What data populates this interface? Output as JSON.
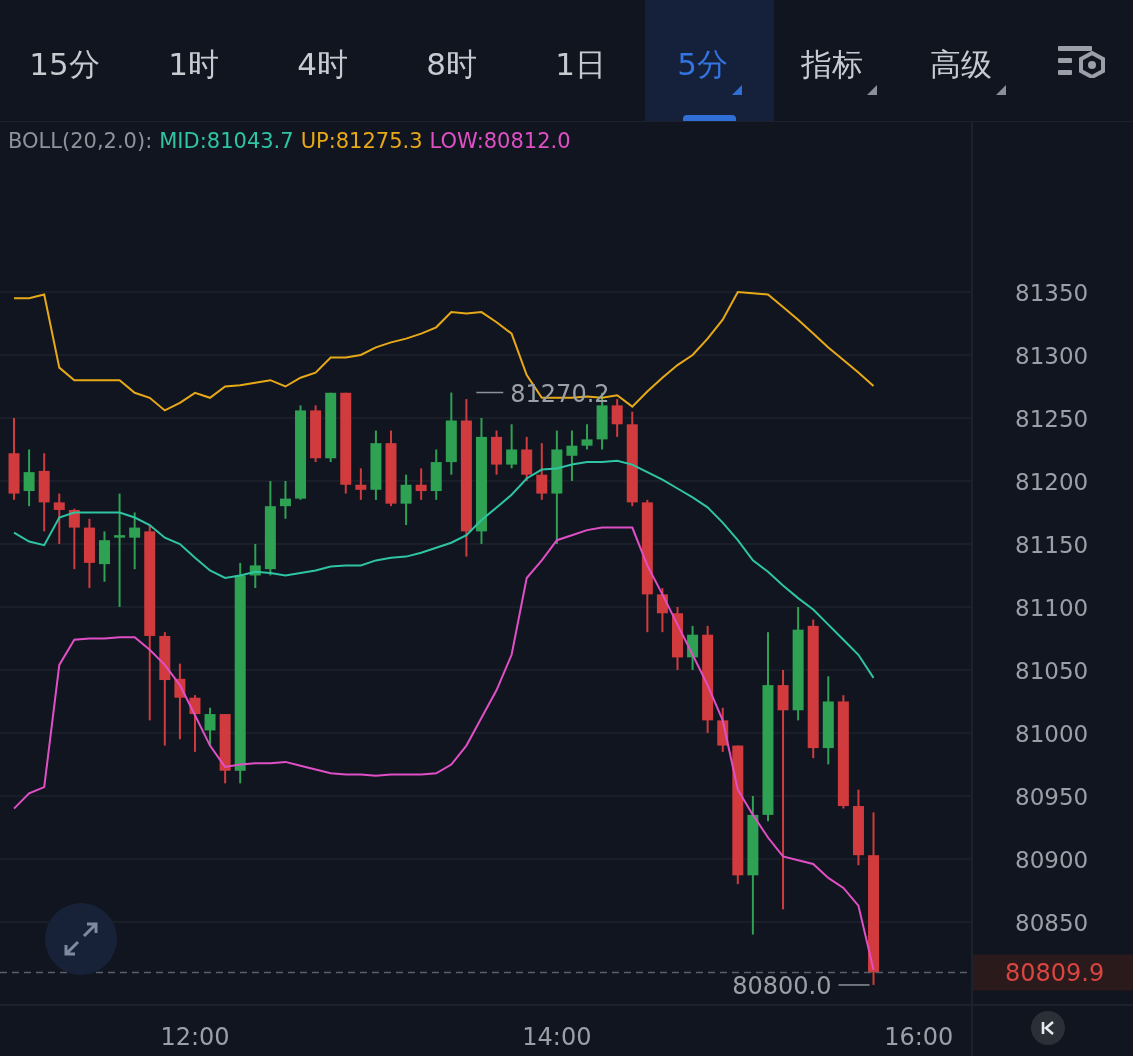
{
  "tabs": [
    {
      "label": "15分",
      "selected": false,
      "has_menu": false
    },
    {
      "label": "1时",
      "selected": false,
      "has_menu": false
    },
    {
      "label": "4时",
      "selected": false,
      "has_menu": false
    },
    {
      "label": "8时",
      "selected": false,
      "has_menu": false
    },
    {
      "label": "1日",
      "selected": false,
      "has_menu": false
    },
    {
      "label": "5分",
      "selected": true,
      "has_menu": true
    },
    {
      "label": "指标",
      "selected": false,
      "has_menu": true
    },
    {
      "label": "高级",
      "selected": false,
      "has_menu": true
    }
  ],
  "legend": {
    "title": "BOLL(20,2.0):",
    "values": [
      ":81043.7",
      ":81275.3",
      ":80812.0"
    ]
  },
  "chart_data": {
    "type": "candlestick",
    "x": [
      11,
      11.0833,
      11.1667,
      11.25,
      11.3333,
      11.4167,
      11.5,
      11.5833,
      11.6667,
      11.75,
      11.8333,
      11.9167,
      12,
      12.0833,
      12.1667,
      12.25,
      12.3333,
      12.4167,
      12.5,
      12.5833,
      12.6667,
      12.75,
      12.8333,
      12.9167,
      13,
      13.0833,
      13.1667,
      13.25,
      13.3333,
      13.4167,
      13.5,
      13.5833,
      13.6667,
      13.75,
      13.8333,
      13.9167,
      14,
      14.0833,
      14.1667,
      14.25,
      14.3333,
      14.4167,
      14.5,
      14.5833,
      14.6667,
      14.75,
      14.8333,
      14.9167,
      15,
      15.0833,
      15.1667,
      15.25,
      15.3333,
      15.4167,
      15.5,
      15.5833,
      15.6667,
      15.75
    ],
    "grid": true,
    "xlim": [
      10.9225,
      17.184
    ],
    "ylim": [
      80784.1,
      81484.9
    ],
    "xticks": [
      {
        "value": 12,
        "label": "12:00"
      },
      {
        "value": 14,
        "label": "14:00"
      },
      {
        "value": 16,
        "label": "16:00"
      }
    ],
    "yticks": [
      80850,
      80900,
      80950,
      81000,
      81050,
      81100,
      81150,
      81200,
      81250,
      81300,
      81350
    ],
    "series": [
      {
        "name": "MID",
        "type": "line",
        "color": "#2ec4a4",
        "values": [
          81159,
          81152,
          81149,
          81171,
          81175,
          81175,
          81175,
          81175,
          81171,
          81165,
          81155,
          81150,
          81139,
          81129,
          81123,
          81125,
          81128,
          81127,
          81125,
          81127,
          81129,
          81132,
          81133,
          81133,
          81137,
          81139,
          81140,
          81143,
          81147,
          81151,
          81157,
          81169,
          81179,
          81189,
          81202,
          81209,
          81210,
          81213,
          81215,
          81215,
          81216,
          81213,
          81207,
          81201,
          81194,
          81187,
          81179,
          81167,
          81153,
          81137,
          81128,
          81117,
          81107,
          81098,
          81086,
          81074,
          81062,
          81043.7
        ]
      },
      {
        "name": "UP",
        "type": "line",
        "color": "#e8a918",
        "values": [
          81345,
          81345,
          81348,
          81290,
          81280,
          81280,
          81280,
          81280,
          81270,
          81266,
          81256,
          81262,
          81270,
          81266,
          81275,
          81276,
          81278,
          81280,
          81275,
          81282,
          81286,
          81298,
          81298,
          81300,
          81306,
          81310,
          81313,
          81317,
          81322,
          81334,
          81333,
          81334,
          81326,
          81317,
          81284,
          81266,
          81266,
          81266,
          81267,
          81266,
          81268,
          81259,
          81271,
          81282,
          81292,
          81300,
          81313,
          81328,
          81350,
          81349,
          81348,
          81338,
          81328,
          81317,
          81306,
          81296,
          81286,
          81275.3
        ]
      },
      {
        "name": "LOW",
        "type": "line",
        "color": "#e04fc6",
        "values": [
          80940,
          80952,
          80957,
          81054,
          81074,
          81075,
          81075,
          81076,
          81076,
          81066,
          81054,
          81038,
          81014,
          80990,
          80973,
          80975,
          80976,
          80976,
          80977,
          80974,
          80971,
          80968,
          80967,
          80967,
          80966,
          80967,
          80967,
          80967,
          80968,
          80975,
          80990,
          81012,
          81034,
          81062,
          81123,
          81137,
          81153,
          81157,
          81161,
          81163,
          81163,
          81163,
          81133,
          81110,
          81086,
          81062,
          81038,
          81010,
          80955,
          80935,
          80917,
          80902,
          80899,
          80896,
          80885,
          80877,
          80863,
          80812.0
        ]
      }
    ],
    "ohlc": [
      [
        81222,
        81250,
        81185,
        81190
      ],
      [
        81192,
        81225,
        81180,
        81207
      ],
      [
        81208,
        81222,
        81160,
        81183
      ],
      [
        81183,
        81190,
        81150,
        81177
      ],
      [
        81177,
        81178,
        81130,
        81163
      ],
      [
        81163,
        81170,
        81115,
        81135
      ],
      [
        81134,
        81160,
        81120,
        81153
      ],
      [
        81155,
        81190,
        81100,
        81157
      ],
      [
        81155,
        81175,
        81130,
        81163
      ],
      [
        81160,
        81165,
        81010,
        81077
      ],
      [
        81077,
        81080,
        80990,
        81042
      ],
      [
        81043,
        81055,
        80995,
        81028
      ],
      [
        81028,
        81030,
        80985,
        81015
      ],
      [
        81002,
        81020,
        80990,
        81015
      ],
      [
        81015,
        81015,
        80960,
        80970
      ],
      [
        80970,
        81135,
        80960,
        81125
      ],
      [
        81125,
        81150,
        81115,
        81133
      ],
      [
        81130,
        81200,
        81125,
        81180
      ],
      [
        81180,
        81200,
        81170,
        81186
      ],
      [
        81186,
        81260,
        81185,
        81256
      ],
      [
        81256,
        81260,
        81215,
        81218
      ],
      [
        81218,
        81270,
        81215,
        81270
      ],
      [
        81270,
        81270,
        81190,
        81197
      ],
      [
        81197,
        81210,
        81185,
        81193
      ],
      [
        81193,
        81240,
        81185,
        81230
      ],
      [
        81230,
        81240,
        81180,
        81182
      ],
      [
        81182,
        81205,
        81165,
        81197
      ],
      [
        81197,
        81210,
        81185,
        81192
      ],
      [
        81192,
        81225,
        81185,
        81215
      ],
      [
        81215,
        81270.2,
        81205,
        81248
      ],
      [
        81248,
        81265,
        81140,
        81160
      ],
      [
        81160,
        81250,
        81150,
        81235
      ],
      [
        81235,
        81240,
        81205,
        81213
      ],
      [
        81213,
        81245,
        81210,
        81225
      ],
      [
        81225,
        81235,
        81200,
        81205
      ],
      [
        81205,
        81230,
        81185,
        81190
      ],
      [
        81190,
        81240,
        81150,
        81225
      ],
      [
        81220,
        81240,
        81200,
        81228
      ],
      [
        81228,
        81245,
        81225,
        81233
      ],
      [
        81233,
        81270,
        81225,
        81260
      ],
      [
        81260,
        81265,
        81235,
        81245
      ],
      [
        81245,
        81255,
        81180,
        81183
      ],
      [
        81183,
        81185,
        81080,
        81110
      ],
      [
        81110,
        81115,
        81080,
        81095
      ],
      [
        81095,
        81100,
        81050,
        81060
      ],
      [
        81060,
        81085,
        81050,
        81078
      ],
      [
        81078,
        81085,
        81000,
        81010
      ],
      [
        81010,
        81020,
        80985,
        80990
      ],
      [
        80990,
        80990,
        80880,
        80887
      ],
      [
        80887,
        80950,
        80840,
        80935
      ],
      [
        80935,
        81080,
        80930,
        81038
      ],
      [
        81038,
        81050,
        80860,
        81018
      ],
      [
        81018,
        81100,
        81010,
        81082
      ],
      [
        81085,
        81090,
        80980,
        80988
      ],
      [
        80988,
        81045,
        80975,
        81025
      ],
      [
        81025,
        81030,
        80940,
        80942
      ],
      [
        80942,
        80955,
        80895,
        80903
      ],
      [
        80903,
        80937,
        80800.0,
        80809.9
      ]
    ],
    "annotations": [
      {
        "x": 13.4167,
        "y": 81270.2,
        "text": "81270.2"
      },
      {
        "x": 15.75,
        "y": 80800.0,
        "text": "80800.0"
      }
    ],
    "ref_lines": [
      {
        "axis": "y",
        "value": 80809.9,
        "label": "80809.9"
      }
    ]
  }
}
